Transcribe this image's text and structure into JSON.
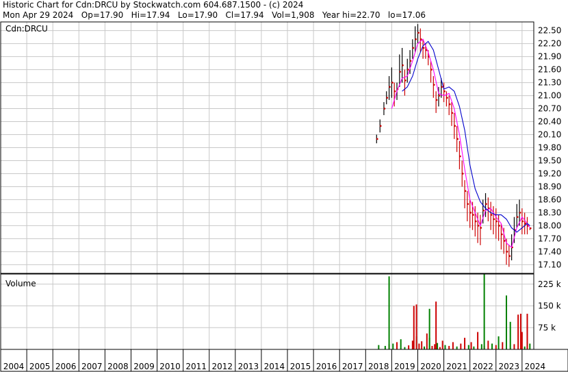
{
  "header": {
    "line1": "Historic Chart for Cdn:DRCU by Stockwatch.com 604.687.1500 - (c) 2024",
    "line2": "Mon Apr 29 2024   Op=17.90   Hi=17.94   Lo=17.90   Cl=17.94   Vol=1,908   Year hi=22.70   lo=17.06"
  },
  "price_panel": {
    "label": "Cdn:DRCU"
  },
  "volume_panel": {
    "label": "Volume"
  },
  "colors": {
    "up": "#008000",
    "down": "#cc0000",
    "ma_fast": "#ff00ff",
    "ma_slow": "#0000cc",
    "grid": "#c8c8c8",
    "frame": "#000000"
  },
  "chart_data": [
    {
      "type": "line",
      "title": "Cdn:DRCU",
      "x_axis": {
        "range": [
          2004,
          2024.45
        ],
        "tick_labels": [
          "2004",
          "2005",
          "2006",
          "2007",
          "2008",
          "2009",
          "2010",
          "2011",
          "2012",
          "2013",
          "2014",
          "2015",
          "2016",
          "2017",
          "2018",
          "2019",
          "2020",
          "2021",
          "2022",
          "2023",
          "2024"
        ]
      },
      "y_axis": {
        "range": [
          16.9,
          22.7
        ],
        "tick_labels": [
          "22.50",
          "22.20",
          "21.90",
          "21.60",
          "21.30",
          "21.00",
          "20.70",
          "20.40",
          "20.10",
          "19.80",
          "19.50",
          "19.20",
          "18.90",
          "18.60",
          "18.30",
          "18.00",
          "17.70",
          "17.40",
          "17.10"
        ]
      },
      "grid": true,
      "series": [
        {
          "style": "price",
          "x": [
            2018.42,
            2018.55,
            2018.7,
            2018.8,
            2018.9,
            2019.0,
            2019.1,
            2019.2,
            2019.3,
            2019.4,
            2019.5,
            2019.6,
            2019.7,
            2019.8,
            2019.9,
            2020.0,
            2020.1,
            2020.2,
            2020.3,
            2020.4,
            2020.5,
            2020.6,
            2020.7,
            2020.8,
            2020.9,
            2021.0,
            2021.1,
            2021.2,
            2021.3,
            2021.4,
            2021.5,
            2021.6,
            2021.7,
            2021.8,
            2021.9,
            2022.0,
            2022.1,
            2022.2,
            2022.3,
            2022.4,
            2022.5,
            2022.6,
            2022.7,
            2022.8,
            2022.9,
            2023.0,
            2023.1,
            2023.2,
            2023.3,
            2023.4,
            2023.5,
            2023.6,
            2023.7,
            2023.8,
            2023.9,
            2024.0,
            2024.1,
            2024.2,
            2024.3
          ],
          "y": [
            20.0,
            20.3,
            20.7,
            20.95,
            21.2,
            21.3,
            21.1,
            21.15,
            21.55,
            21.7,
            21.35,
            21.6,
            21.8,
            22.1,
            22.3,
            22.45,
            22.3,
            22.1,
            22.05,
            21.9,
            21.6,
            21.25,
            20.9,
            21.0,
            21.2,
            21.1,
            20.95,
            20.8,
            20.6,
            20.3,
            20.0,
            19.6,
            19.2,
            18.8,
            18.5,
            18.3,
            18.25,
            18.1,
            18.0,
            17.95,
            18.35,
            18.5,
            18.4,
            18.25,
            18.15,
            18.1,
            18.0,
            17.8,
            17.65,
            17.4,
            17.3,
            17.5,
            17.9,
            18.2,
            18.3,
            18.1,
            18.05,
            18.0,
            17.94
          ],
          "hi": [
            20.1,
            20.45,
            20.85,
            21.1,
            21.45,
            21.65,
            21.3,
            21.3,
            21.95,
            22.1,
            21.6,
            21.85,
            22.05,
            22.3,
            22.6,
            22.65,
            22.55,
            22.3,
            22.2,
            22.05,
            21.8,
            21.45,
            21.1,
            21.2,
            21.4,
            21.3,
            21.1,
            21.0,
            20.85,
            20.6,
            20.3,
            19.95,
            19.5,
            19.05,
            18.8,
            18.6,
            18.55,
            18.45,
            18.3,
            18.25,
            18.6,
            18.75,
            18.65,
            18.55,
            18.45,
            18.4,
            18.25,
            18.05,
            17.95,
            17.7,
            17.55,
            17.8,
            18.2,
            18.5,
            18.6,
            18.4,
            18.3,
            18.2,
            17.94
          ],
          "lo": [
            19.9,
            20.15,
            20.55,
            20.8,
            20.9,
            20.95,
            20.75,
            20.9,
            21.2,
            21.3,
            21.0,
            21.3,
            21.5,
            21.85,
            22.0,
            22.2,
            22.0,
            21.85,
            21.85,
            21.7,
            21.3,
            20.95,
            20.6,
            20.75,
            20.95,
            20.85,
            20.75,
            20.55,
            20.3,
            20.0,
            19.7,
            19.3,
            18.9,
            18.4,
            18.1,
            17.95,
            17.9,
            17.75,
            17.6,
            17.55,
            18.05,
            18.2,
            18.1,
            17.9,
            17.8,
            17.7,
            17.65,
            17.45,
            17.35,
            17.1,
            17.05,
            17.2,
            17.6,
            17.95,
            18.0,
            17.8,
            17.8,
            17.8,
            17.9
          ]
        },
        {
          "style": "ma_fast",
          "x": [
            2019.0,
            2019.2,
            2019.4,
            2019.6,
            2019.8,
            2020.0,
            2020.2,
            2020.4,
            2020.6,
            2020.8,
            2021.0,
            2021.2,
            2021.4,
            2021.6,
            2021.8,
            2022.0,
            2022.2,
            2022.4,
            2022.6,
            2022.8,
            2023.0,
            2023.2,
            2023.4,
            2023.6,
            2023.8,
            2024.0,
            2024.2,
            2024.3
          ],
          "y": [
            20.7,
            21.1,
            21.4,
            21.45,
            21.8,
            22.2,
            22.3,
            22.0,
            21.6,
            21.05,
            21.0,
            21.05,
            20.7,
            20.1,
            19.3,
            18.6,
            18.3,
            18.0,
            18.35,
            18.4,
            18.2,
            18.05,
            17.6,
            17.5,
            17.95,
            18.2,
            18.05,
            17.95
          ]
        },
        {
          "style": "ma_slow",
          "x": [
            2019.4,
            2019.6,
            2019.8,
            2020.0,
            2020.2,
            2020.4,
            2020.6,
            2020.8,
            2021.0,
            2021.2,
            2021.4,
            2021.6,
            2021.8,
            2022.0,
            2022.2,
            2022.4,
            2022.6,
            2022.8,
            2023.0,
            2023.2,
            2023.4,
            2023.6,
            2023.8,
            2024.0,
            2024.2,
            2024.3
          ],
          "y": [
            21.1,
            21.2,
            21.45,
            21.85,
            22.15,
            22.25,
            22.05,
            21.6,
            21.15,
            21.2,
            21.1,
            20.75,
            20.2,
            19.4,
            18.85,
            18.55,
            18.4,
            18.3,
            18.25,
            18.25,
            18.15,
            17.95,
            17.85,
            17.95,
            18.05,
            18.0
          ]
        }
      ]
    },
    {
      "type": "bar",
      "title": "Volume",
      "y_axis": {
        "range": [
          0,
          260
        ],
        "tick_labels": [
          "225 k",
          "150 k",
          "75 k"
        ]
      },
      "x": [
        2018.5,
        2018.75,
        2018.9,
        2019.05,
        2019.2,
        2019.35,
        2019.5,
        2019.65,
        2019.8,
        2019.95,
        2020.05,
        2020.15,
        2020.25,
        2020.35,
        2020.45,
        2020.55,
        2020.65,
        2020.75,
        2020.85,
        2020.95,
        2021.05,
        2021.2,
        2021.35,
        2021.5,
        2021.65,
        2021.8,
        2021.95,
        2022.05,
        2022.15,
        2022.3,
        2022.45,
        2022.55,
        2022.7,
        2022.85,
        2023.0,
        2023.1,
        2023.25,
        2023.4,
        2023.55,
        2023.7,
        2023.85,
        2024.0,
        2024.1,
        2024.2,
        2024.3
      ],
      "values": [
        15,
        12,
        18,
        20,
        25,
        35,
        8,
        14,
        30,
        45,
        20,
        28,
        10,
        55,
        40,
        12,
        18,
        22,
        8,
        30,
        15,
        12,
        25,
        10,
        20,
        40,
        15,
        25,
        10,
        60,
        18,
        12,
        30,
        20,
        15,
        45,
        25,
        20,
        95,
        18,
        120,
        60,
        10,
        85,
        20
      ],
      "direction": [
        "up",
        "up",
        "down",
        "up",
        "down",
        "up",
        "up",
        "down",
        "down",
        "up",
        "down",
        "down",
        "up",
        "down",
        "up",
        "down",
        "down",
        "up",
        "down",
        "down",
        "up",
        "down",
        "down",
        "up",
        "down",
        "down",
        "up",
        "down",
        "up",
        "down",
        "up",
        "down",
        "down",
        "up",
        "down",
        "up",
        "down",
        "down",
        "up",
        "down",
        "down",
        "down",
        "up",
        "down",
        "up"
      ],
      "spikes": [
        {
          "x": 2018.9,
          "value": 252,
          "direction": "up"
        },
        {
          "x": 2019.85,
          "value": 150,
          "direction": "down"
        },
        {
          "x": 2019.95,
          "value": 155,
          "direction": "down"
        },
        {
          "x": 2020.7,
          "value": 165,
          "direction": "down"
        },
        {
          "x": 2020.45,
          "value": 140,
          "direction": "up"
        },
        {
          "x": 2022.55,
          "value": 275,
          "direction": "up"
        },
        {
          "x": 2023.4,
          "value": 186,
          "direction": "up"
        },
        {
          "x": 2023.95,
          "value": 123,
          "direction": "down"
        },
        {
          "x": 2024.2,
          "value": 123,
          "direction": "down"
        }
      ]
    }
  ]
}
